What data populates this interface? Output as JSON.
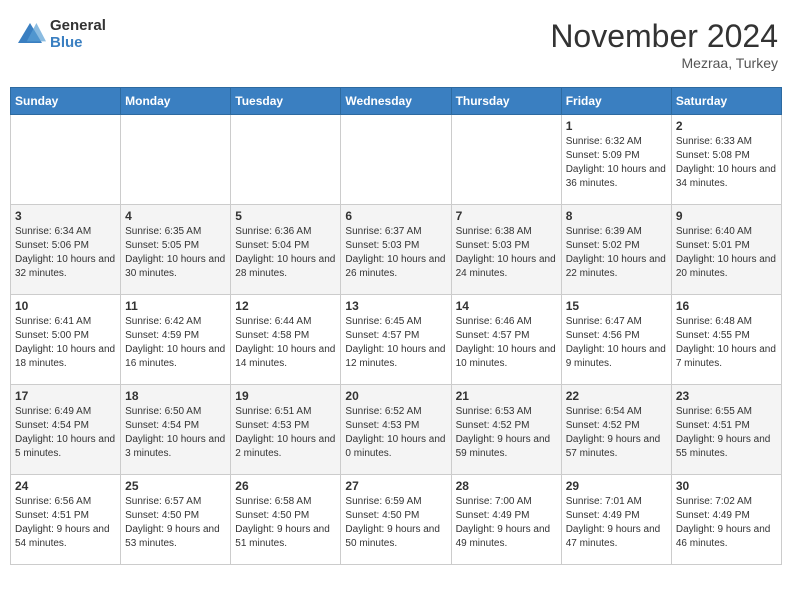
{
  "header": {
    "logo_general": "General",
    "logo_blue": "Blue",
    "month_title": "November 2024",
    "subtitle": "Mezraa, Turkey"
  },
  "days_of_week": [
    "Sunday",
    "Monday",
    "Tuesday",
    "Wednesday",
    "Thursday",
    "Friday",
    "Saturday"
  ],
  "weeks": [
    [
      {
        "day": "",
        "info": ""
      },
      {
        "day": "",
        "info": ""
      },
      {
        "day": "",
        "info": ""
      },
      {
        "day": "",
        "info": ""
      },
      {
        "day": "",
        "info": ""
      },
      {
        "day": "1",
        "info": "Sunrise: 6:32 AM\nSunset: 5:09 PM\nDaylight: 10 hours and 36 minutes."
      },
      {
        "day": "2",
        "info": "Sunrise: 6:33 AM\nSunset: 5:08 PM\nDaylight: 10 hours and 34 minutes."
      }
    ],
    [
      {
        "day": "3",
        "info": "Sunrise: 6:34 AM\nSunset: 5:06 PM\nDaylight: 10 hours and 32 minutes."
      },
      {
        "day": "4",
        "info": "Sunrise: 6:35 AM\nSunset: 5:05 PM\nDaylight: 10 hours and 30 minutes."
      },
      {
        "day": "5",
        "info": "Sunrise: 6:36 AM\nSunset: 5:04 PM\nDaylight: 10 hours and 28 minutes."
      },
      {
        "day": "6",
        "info": "Sunrise: 6:37 AM\nSunset: 5:03 PM\nDaylight: 10 hours and 26 minutes."
      },
      {
        "day": "7",
        "info": "Sunrise: 6:38 AM\nSunset: 5:03 PM\nDaylight: 10 hours and 24 minutes."
      },
      {
        "day": "8",
        "info": "Sunrise: 6:39 AM\nSunset: 5:02 PM\nDaylight: 10 hours and 22 minutes."
      },
      {
        "day": "9",
        "info": "Sunrise: 6:40 AM\nSunset: 5:01 PM\nDaylight: 10 hours and 20 minutes."
      }
    ],
    [
      {
        "day": "10",
        "info": "Sunrise: 6:41 AM\nSunset: 5:00 PM\nDaylight: 10 hours and 18 minutes."
      },
      {
        "day": "11",
        "info": "Sunrise: 6:42 AM\nSunset: 4:59 PM\nDaylight: 10 hours and 16 minutes."
      },
      {
        "day": "12",
        "info": "Sunrise: 6:44 AM\nSunset: 4:58 PM\nDaylight: 10 hours and 14 minutes."
      },
      {
        "day": "13",
        "info": "Sunrise: 6:45 AM\nSunset: 4:57 PM\nDaylight: 10 hours and 12 minutes."
      },
      {
        "day": "14",
        "info": "Sunrise: 6:46 AM\nSunset: 4:57 PM\nDaylight: 10 hours and 10 minutes."
      },
      {
        "day": "15",
        "info": "Sunrise: 6:47 AM\nSunset: 4:56 PM\nDaylight: 10 hours and 9 minutes."
      },
      {
        "day": "16",
        "info": "Sunrise: 6:48 AM\nSunset: 4:55 PM\nDaylight: 10 hours and 7 minutes."
      }
    ],
    [
      {
        "day": "17",
        "info": "Sunrise: 6:49 AM\nSunset: 4:54 PM\nDaylight: 10 hours and 5 minutes."
      },
      {
        "day": "18",
        "info": "Sunrise: 6:50 AM\nSunset: 4:54 PM\nDaylight: 10 hours and 3 minutes."
      },
      {
        "day": "19",
        "info": "Sunrise: 6:51 AM\nSunset: 4:53 PM\nDaylight: 10 hours and 2 minutes."
      },
      {
        "day": "20",
        "info": "Sunrise: 6:52 AM\nSunset: 4:53 PM\nDaylight: 10 hours and 0 minutes."
      },
      {
        "day": "21",
        "info": "Sunrise: 6:53 AM\nSunset: 4:52 PM\nDaylight: 9 hours and 59 minutes."
      },
      {
        "day": "22",
        "info": "Sunrise: 6:54 AM\nSunset: 4:52 PM\nDaylight: 9 hours and 57 minutes."
      },
      {
        "day": "23",
        "info": "Sunrise: 6:55 AM\nSunset: 4:51 PM\nDaylight: 9 hours and 55 minutes."
      }
    ],
    [
      {
        "day": "24",
        "info": "Sunrise: 6:56 AM\nSunset: 4:51 PM\nDaylight: 9 hours and 54 minutes."
      },
      {
        "day": "25",
        "info": "Sunrise: 6:57 AM\nSunset: 4:50 PM\nDaylight: 9 hours and 53 minutes."
      },
      {
        "day": "26",
        "info": "Sunrise: 6:58 AM\nSunset: 4:50 PM\nDaylight: 9 hours and 51 minutes."
      },
      {
        "day": "27",
        "info": "Sunrise: 6:59 AM\nSunset: 4:50 PM\nDaylight: 9 hours and 50 minutes."
      },
      {
        "day": "28",
        "info": "Sunrise: 7:00 AM\nSunset: 4:49 PM\nDaylight: 9 hours and 49 minutes."
      },
      {
        "day": "29",
        "info": "Sunrise: 7:01 AM\nSunset: 4:49 PM\nDaylight: 9 hours and 47 minutes."
      },
      {
        "day": "30",
        "info": "Sunrise: 7:02 AM\nSunset: 4:49 PM\nDaylight: 9 hours and 46 minutes."
      }
    ]
  ]
}
